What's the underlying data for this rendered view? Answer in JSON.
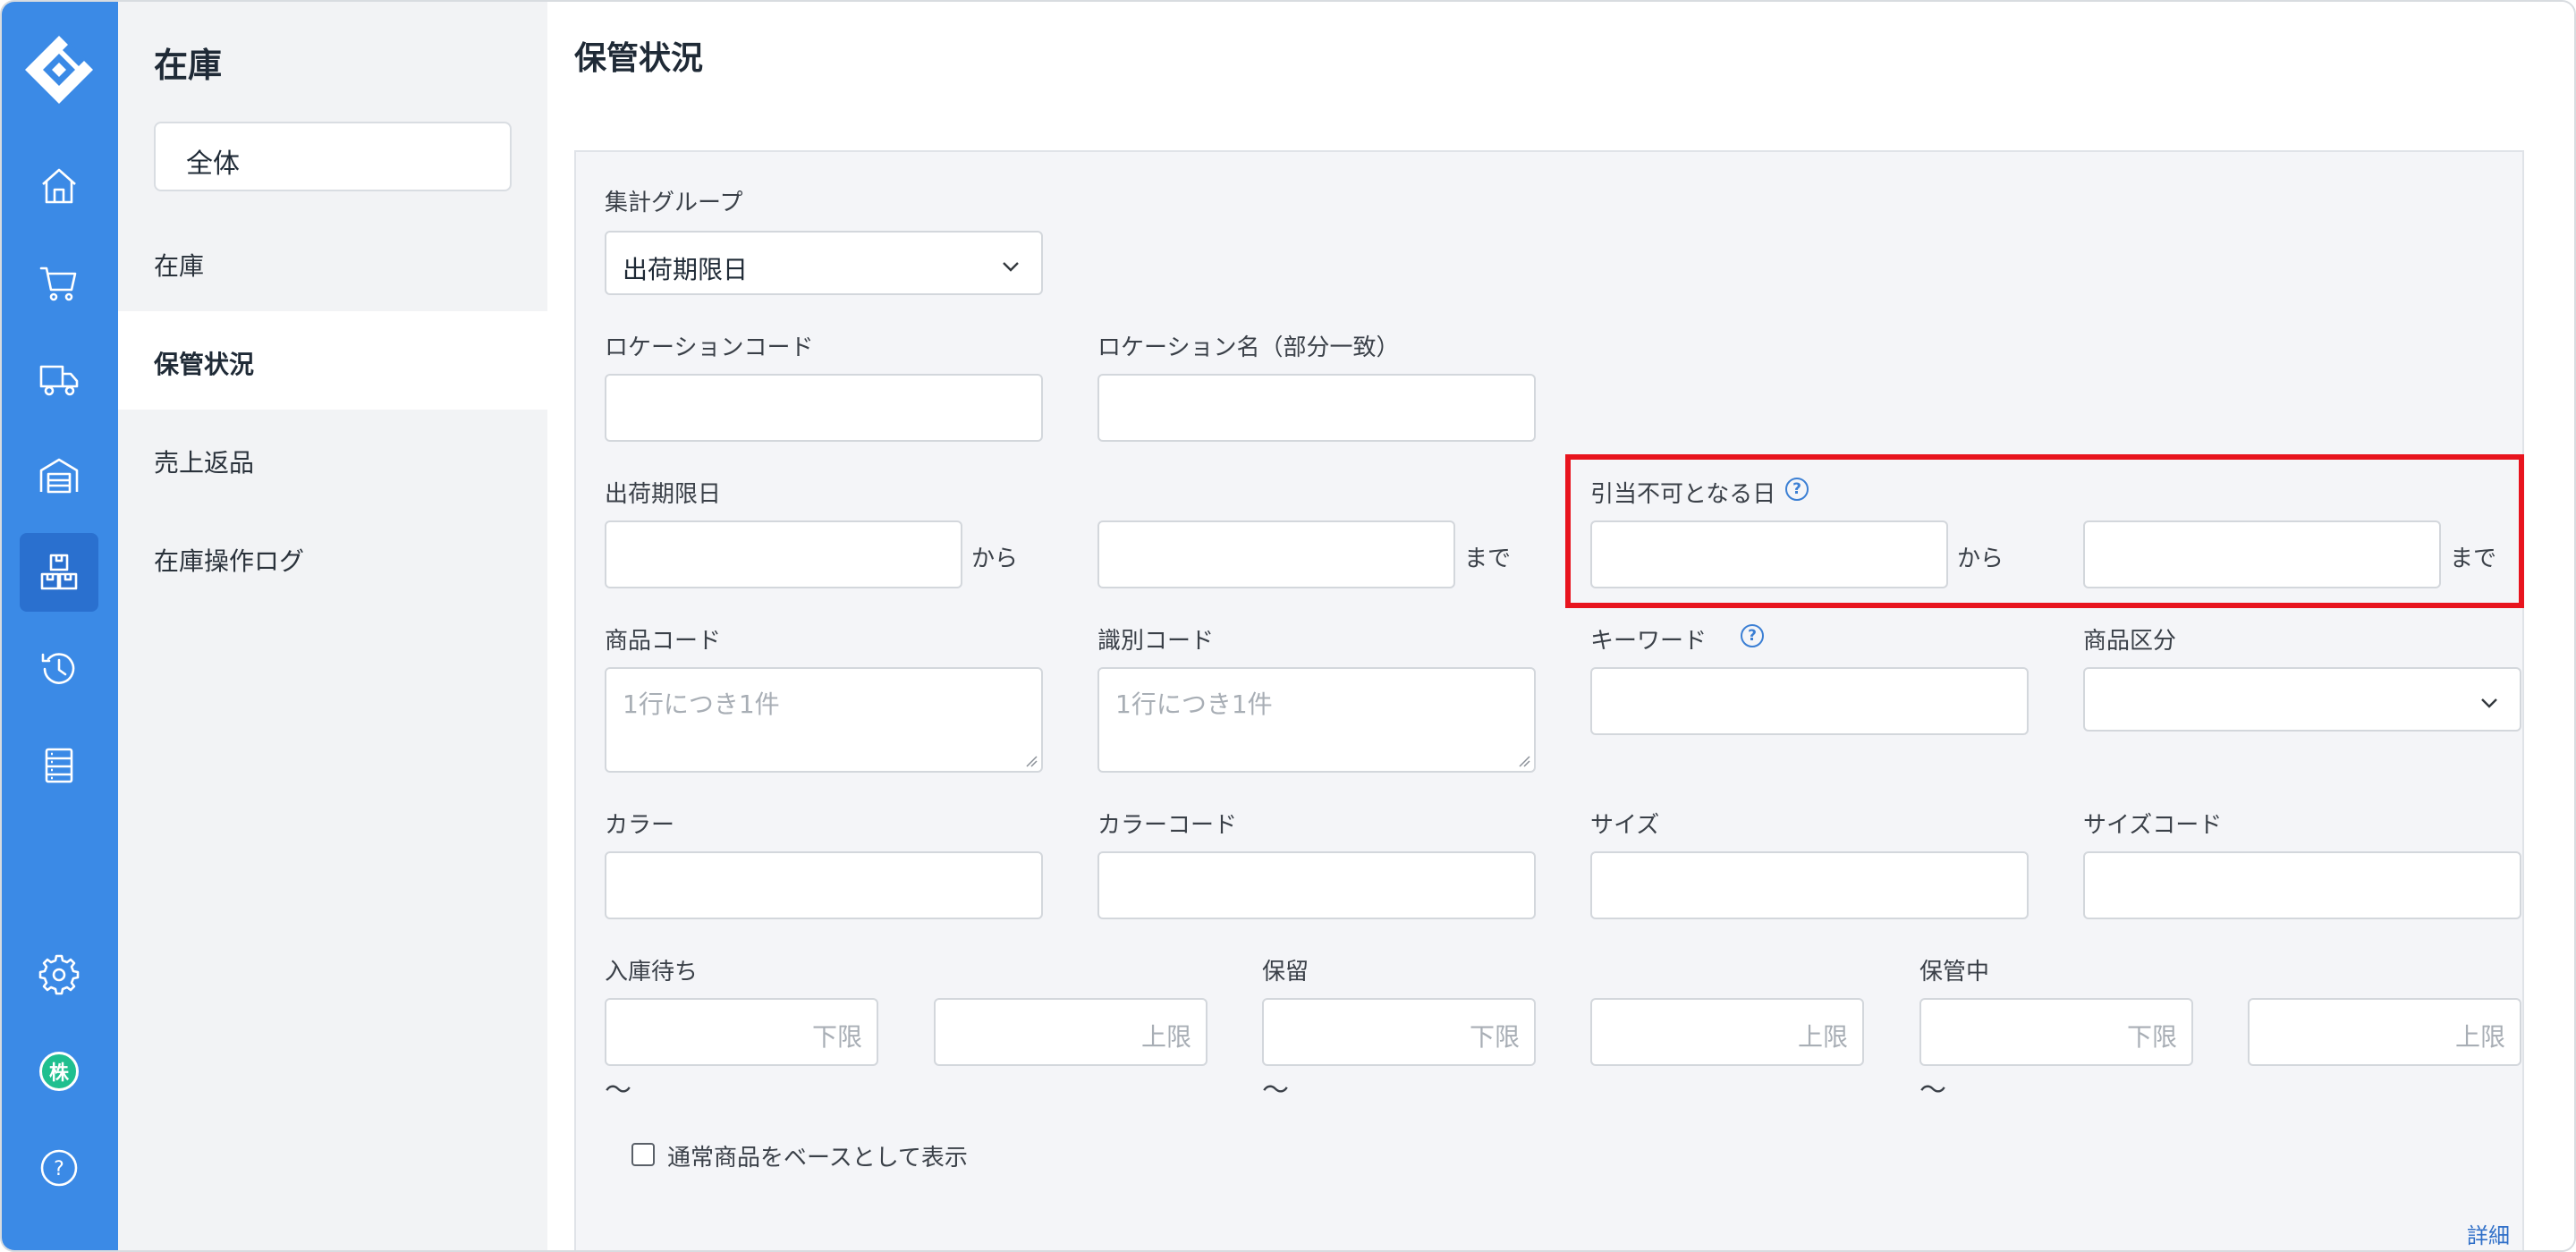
{
  "rail": {
    "items": [
      {
        "name": "home-icon"
      },
      {
        "name": "cart-icon"
      },
      {
        "name": "truck-icon"
      },
      {
        "name": "warehouse-icon"
      },
      {
        "name": "inventory-boxes-icon",
        "active": true
      },
      {
        "name": "history-icon"
      },
      {
        "name": "list-document-icon"
      },
      {
        "name": "gear-icon"
      },
      {
        "name": "company-avatar"
      },
      {
        "name": "help-icon"
      }
    ],
    "avatar_text": "株",
    "help_glyph": "?"
  },
  "subnav": {
    "title": "在庫",
    "scope": "全体",
    "items": [
      {
        "label": "在庫",
        "active": false
      },
      {
        "label": "保管状況",
        "active": true
      },
      {
        "label": "売上返品",
        "active": false
      },
      {
        "label": "在庫操作ログ",
        "active": false
      }
    ]
  },
  "page": {
    "title": "保管状況"
  },
  "form": {
    "group": {
      "label": "集計グループ",
      "value": "出荷期限日"
    },
    "location_code": {
      "label": "ロケーションコード",
      "value": ""
    },
    "location_name": {
      "label": "ロケーション名（部分一致）",
      "value": ""
    },
    "ship_deadline": {
      "label": "出荷期限日",
      "from_suffix": "から",
      "to_suffix": "まで"
    },
    "unallocatable_date": {
      "label": "引当不可となる日",
      "from_suffix": "から",
      "to_suffix": "まで"
    },
    "product_code": {
      "label": "商品コード",
      "placeholder": "1行につき1件"
    },
    "identification_code": {
      "label": "識別コード",
      "placeholder": "1行につき1件"
    },
    "keyword": {
      "label": "キーワード",
      "value": ""
    },
    "product_category": {
      "label": "商品区分",
      "value": ""
    },
    "color": {
      "label": "カラー",
      "value": ""
    },
    "color_code": {
      "label": "カラーコード",
      "value": ""
    },
    "size": {
      "label": "サイズ",
      "value": ""
    },
    "size_code": {
      "label": "サイズコード",
      "value": ""
    },
    "awaiting_receipt": {
      "label": "入庫待ち",
      "min_placeholder": "下限",
      "max_placeholder": "上限"
    },
    "on_hold": {
      "label": "保留",
      "min_placeholder": "下限",
      "max_placeholder": "上限"
    },
    "in_storage": {
      "label": "保管中",
      "min_placeholder": "下限",
      "max_placeholder": "上限"
    },
    "range_separator": "〜",
    "help_glyph": "?",
    "base_on_normal_product": {
      "label": "通常商品をベースとして表示",
      "checked": false
    },
    "advanced_search_link": "詳細検索"
  },
  "colors": {
    "rail": "#3b8ae6",
    "rail_active": "#2a70cf",
    "highlight_border": "#e8141e",
    "link": "#2f6fc8"
  }
}
